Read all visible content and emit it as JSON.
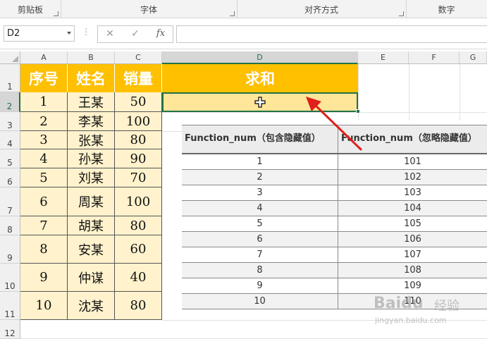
{
  "ribbon": {
    "groups": [
      "剪贴板",
      "字体",
      "对齐方式",
      "数字"
    ]
  },
  "formula_bar": {
    "name_box": "D2",
    "cancel_icon": "✕",
    "confirm_icon": "✓",
    "fx_label": "fx",
    "formula": ""
  },
  "columns": [
    "A",
    "B",
    "C",
    "D",
    "E",
    "F",
    "G"
  ],
  "rows": [
    "1",
    "2",
    "3",
    "4",
    "5",
    "6",
    "7",
    "8",
    "9",
    "10",
    "11",
    "12"
  ],
  "sheet": {
    "headers": [
      "序号",
      "姓名",
      "销量",
      "求和"
    ],
    "data": [
      [
        "1",
        "王某",
        "50"
      ],
      [
        "2",
        "李某",
        "100"
      ],
      [
        "3",
        "张某",
        "80"
      ],
      [
        "4",
        "孙某",
        "90"
      ],
      [
        "5",
        "刘某",
        "70"
      ],
      [
        "6",
        "周某",
        "100"
      ],
      [
        "7",
        "胡某",
        "80"
      ],
      [
        "8",
        "安某",
        "60"
      ],
      [
        "9",
        "仲谋",
        "40"
      ],
      [
        "10",
        "沈某",
        "80"
      ]
    ]
  },
  "function_table": {
    "col1_header": "Function_num（包含隐藏值）",
    "col2_header": "Function_num（忽略隐藏值）",
    "rows": [
      [
        "1",
        "101"
      ],
      [
        "2",
        "102"
      ],
      [
        "3",
        "103"
      ],
      [
        "4",
        "104"
      ],
      [
        "5",
        "105"
      ],
      [
        "6",
        "106"
      ],
      [
        "7",
        "107"
      ],
      [
        "8",
        "108"
      ],
      [
        "9",
        "109"
      ],
      [
        "10",
        "110"
      ]
    ]
  },
  "watermark": {
    "brand": "Baidu",
    "brand_cn": "经验",
    "url": "jingyan.baidu.com"
  },
  "colors": {
    "header_fill": "#ffc000",
    "data_fill": "#fff2cc",
    "selection": "#217346",
    "arrow": "#e0201b"
  },
  "icons": {
    "cursor": "cross-cursor-icon",
    "arrow": "red-arrow-icon"
  }
}
